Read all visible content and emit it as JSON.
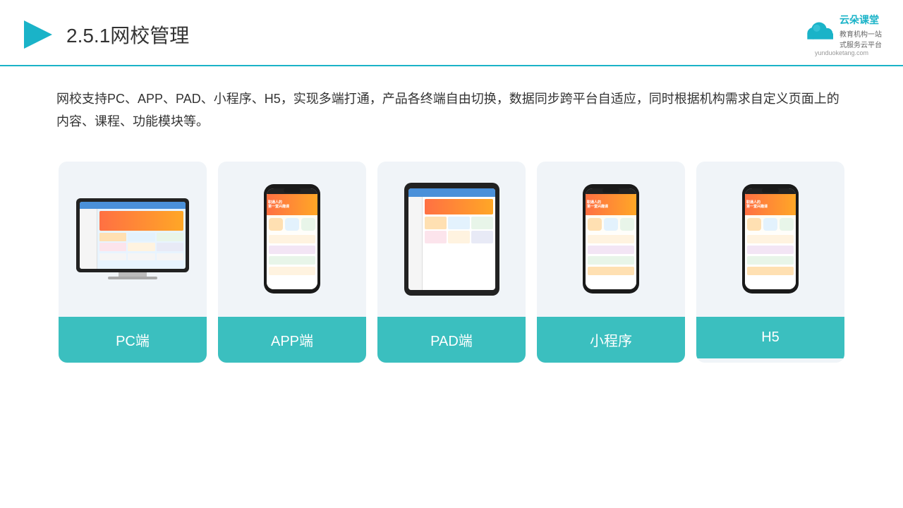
{
  "header": {
    "title": "2.5.1网校管理",
    "logo": {
      "name": "云朵课堂",
      "url": "yunduoketang.com",
      "tagline": "教育机构一站\n式服务云平台"
    }
  },
  "description": {
    "text": "网校支持PC、APP、PAD、小程序、H5，实现多端打通，产品各终端自由切换，数据同步跨平台自适应，同时根据机构需求自定义页面上的内容、课程、功能模块等。"
  },
  "cards": [
    {
      "id": "pc",
      "label": "PC端"
    },
    {
      "id": "app",
      "label": "APP端"
    },
    {
      "id": "pad",
      "label": "PAD端"
    },
    {
      "id": "miniprogram",
      "label": "小程序"
    },
    {
      "id": "h5",
      "label": "H5"
    }
  ],
  "accent_color": "#3bbfbf",
  "border_color": "#1ab3c8"
}
